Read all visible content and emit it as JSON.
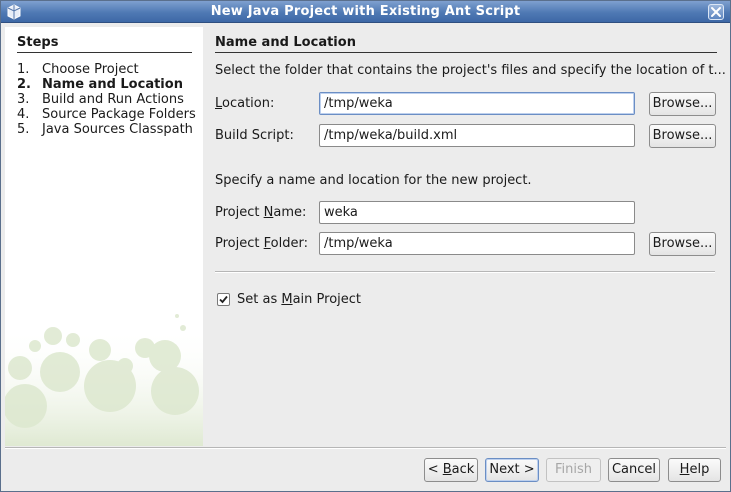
{
  "window": {
    "title": "New Java Project with Existing Ant Script",
    "app_icon": "java-cup-icon",
    "close_icon": "close-icon"
  },
  "steps": {
    "heading": "Steps",
    "items": [
      {
        "num": "1.",
        "label": "Choose Project",
        "current": false
      },
      {
        "num": "2.",
        "label": "Name and Location",
        "current": true
      },
      {
        "num": "3.",
        "label": "Build and Run Actions",
        "current": false
      },
      {
        "num": "4.",
        "label": "Source Package Folders",
        "current": false
      },
      {
        "num": "5.",
        "label": "Java Sources Classpath",
        "current": false
      }
    ]
  },
  "main": {
    "heading": "Name and Location",
    "description": "Select the folder that contains the project's files and specify the location of t...",
    "location": {
      "label": "Location:",
      "mnemonic": "L",
      "rest": "ocation:",
      "value": "/tmp/weka"
    },
    "build_script": {
      "label": "Build Script:",
      "value": "/tmp/weka/build.xml"
    },
    "new_project_description": "Specify a name and location for the new project.",
    "project_name": {
      "label": "Project Name:",
      "pre": "Project ",
      "mnemonic": "N",
      "rest": "ame:",
      "value": "weka"
    },
    "project_folder": {
      "label": "Project Folder:",
      "pre": "Project ",
      "mnemonic": "F",
      "rest": "older:",
      "value": "/tmp/weka"
    },
    "browse_label": "Browse...",
    "main_project": {
      "pre": "Set as ",
      "mnemonic": "M",
      "rest": "ain Project",
      "checked": true
    }
  },
  "footer": {
    "back": {
      "pre": "< ",
      "mnemonic": "B",
      "rest": "ack"
    },
    "next": {
      "label": "Next >"
    },
    "finish": {
      "label": "Finish",
      "enabled": false
    },
    "cancel": {
      "label": "Cancel"
    },
    "help": {
      "mnemonic": "H",
      "rest": "elp"
    }
  },
  "colors": {
    "titlebar": "#4f79b4",
    "panel_bg": "#ffffff",
    "window_bg": "#ececec",
    "focus_border": "#6b8ec4"
  }
}
